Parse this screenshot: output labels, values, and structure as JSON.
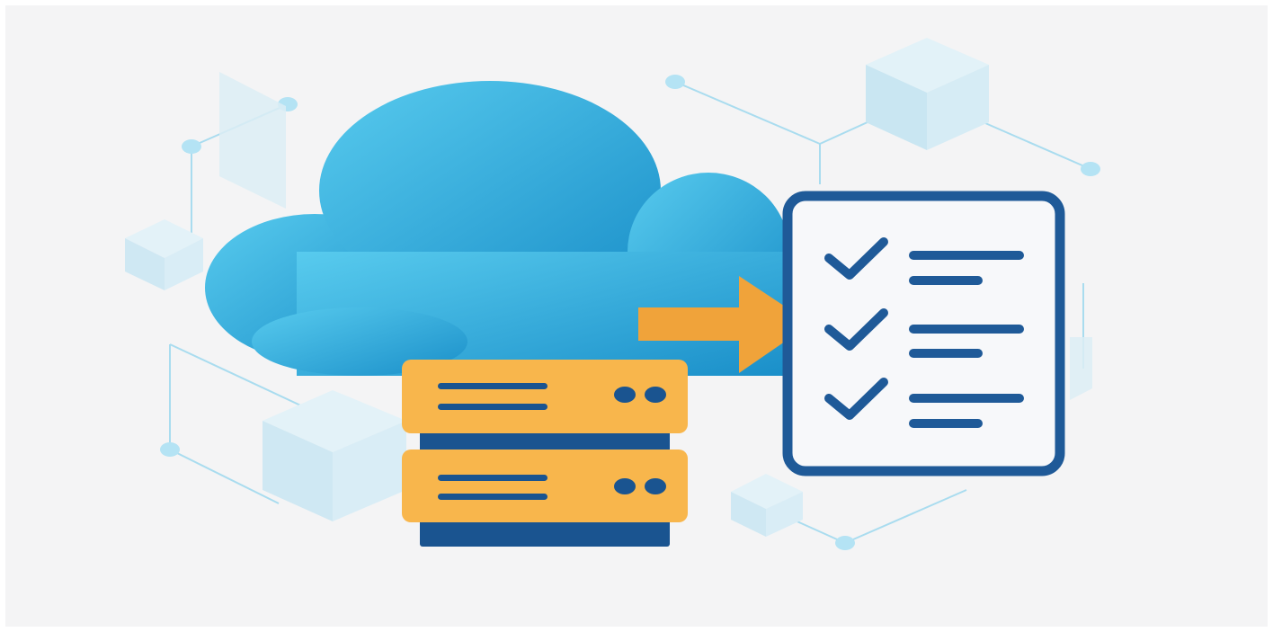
{
  "illustration": {
    "subject": "cloud-server-checklist",
    "colors": {
      "background": "#f4f4f5",
      "cloud_light": "#52c6ea",
      "cloud_dark": "#1c92cb",
      "server_yellow": "#f8b64c",
      "server_navy": "#1a5490",
      "arrow_orange": "#f0a33a",
      "checklist_border": "#1f5a98",
      "checklist_fill": "#f7f8fa",
      "network_line": "#a9dcef",
      "network_node": "#b4e3f4",
      "cube_face": "#d7edf6"
    },
    "icons": [
      "cloud-icon",
      "server-icon",
      "arrow-right-icon",
      "checklist-icon",
      "check-icon",
      "cube-icon",
      "network-node-icon"
    ],
    "checklist": {
      "items_checked": 3,
      "items_total": 3
    },
    "server": {
      "units": 2
    }
  }
}
